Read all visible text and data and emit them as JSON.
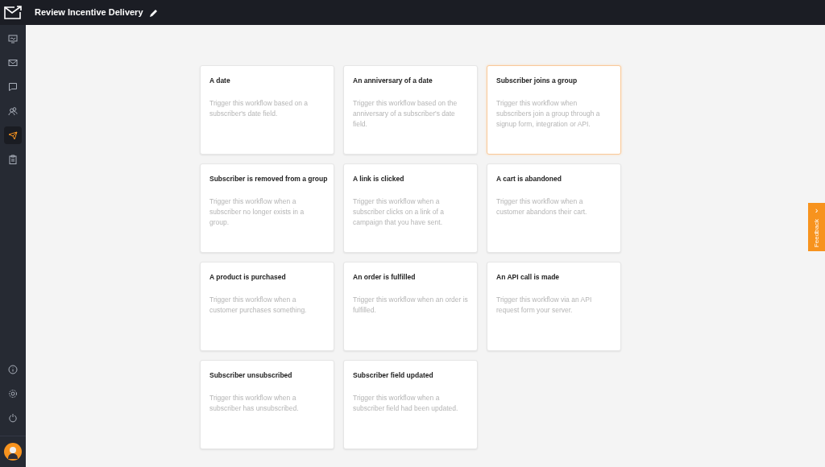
{
  "header": {
    "title": "Review Incentive Delivery"
  },
  "sidebar": {
    "items": [
      {
        "kind": "monitor",
        "selected": false
      },
      {
        "kind": "mail",
        "selected": false
      },
      {
        "kind": "chat",
        "selected": false
      },
      {
        "kind": "users",
        "selected": false
      },
      {
        "kind": "plane",
        "selected": true
      },
      {
        "kind": "clipboard",
        "selected": false
      }
    ],
    "bottom_items": [
      {
        "kind": "info"
      },
      {
        "kind": "gear"
      },
      {
        "kind": "power"
      }
    ]
  },
  "triggers": [
    {
      "title": "A date",
      "description": "Trigger this workflow based on a subscriber's date field.",
      "selected": false
    },
    {
      "title": "An anniversary of a date",
      "description": "Trigger this workflow based on the anniversary of a subscriber's date field.",
      "selected": false
    },
    {
      "title": "Subscriber joins a group",
      "description": "Trigger this workflow when subscribers join a group through a signup form, integration or API.",
      "selected": true
    },
    {
      "title": "Subscriber is removed from a group",
      "description": "Trigger this workflow when a subscriber no longer exists in a group.",
      "selected": false
    },
    {
      "title": "A link is clicked",
      "description": "Trigger this workflow when a subscriber clicks on a link of a campaign that you have sent.",
      "selected": false
    },
    {
      "title": "A cart is abandoned",
      "description": "Trigger this workflow when a customer abandons their cart.",
      "selected": false
    },
    {
      "title": "A product is purchased",
      "description": "Trigger this workflow when a customer purchases something.",
      "selected": false
    },
    {
      "title": "An order is fulfilled",
      "description": "Trigger this workflow when an order is fulfilled.",
      "selected": false
    },
    {
      "title": "An API call is made",
      "description": "Trigger this workflow via an API request form your server.",
      "selected": false
    },
    {
      "title": "Subscriber unsubscribed",
      "description": "Trigger this workflow when a subscriber has unsubscribed.",
      "selected": false
    },
    {
      "title": "Subscriber field updated",
      "description": "Trigger this workflow when a subscriber field had been updated.",
      "selected": false
    }
  ],
  "feedback": {
    "label": "Feedback",
    "arrow": "›"
  }
}
